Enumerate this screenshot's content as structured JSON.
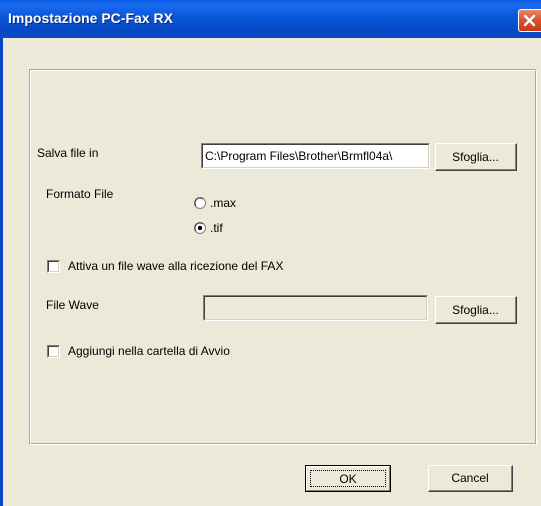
{
  "window": {
    "title": "Impostazione PC-Fax RX"
  },
  "save_file": {
    "label": "Salva file in",
    "path_value": "C:\\Program Files\\Brother\\Brmfl04a\\",
    "browse_label": "Sfoglia..."
  },
  "file_format": {
    "label": "Formato File",
    "options": [
      {
        "label": ".max",
        "selected": false
      },
      {
        "label": ".tif",
        "selected": true
      }
    ]
  },
  "wave_on_receive": {
    "label": "Attiva un file wave alla ricezione del FAX",
    "checked": false
  },
  "wave_file": {
    "label": "File Wave",
    "path_value": "",
    "browse_label": "Sfoglia..."
  },
  "startup_folder": {
    "label": "Aggiungi nella cartella di Avvio",
    "checked": false
  },
  "buttons": {
    "ok_label": "OK",
    "cancel_label": "Cancel"
  },
  "colors": {
    "titlebar": "#0a57d8",
    "dialog_face": "#ece9d8",
    "close_button": "#d8502a"
  }
}
